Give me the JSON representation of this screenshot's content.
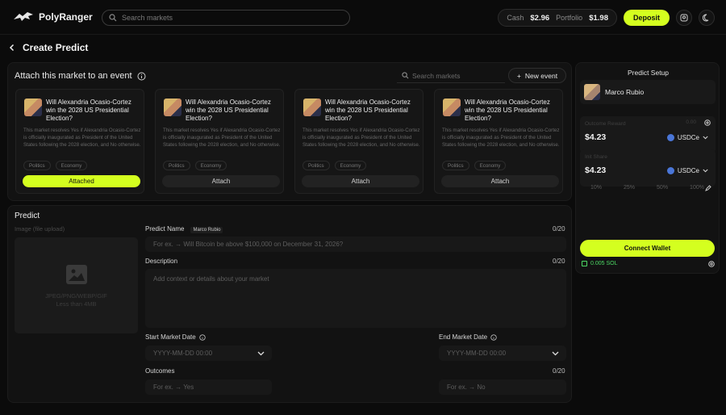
{
  "app": {
    "name": "PolyRanger"
  },
  "header": {
    "search_placeholder": "Search markets",
    "cash_label": "Cash",
    "cash_value": "$2.96",
    "portfolio_label": "Portfolio",
    "portfolio_value": "$1.98",
    "deposit_label": "Deposit"
  },
  "page": {
    "title": "Create Predict",
    "back_icon": "chevron-left-icon"
  },
  "events": {
    "heading": "Attach this market to an event",
    "search_placeholder": "Search markets",
    "new_event_label": "New event",
    "cards": [
      {
        "question": "Will Alexandria Ocasio-Cortez win the 2028 US Presidential Election?",
        "description": "This market resolves Yes if Alexandria Ocasio-Cortez is officially inaugurated as President of the United States following the 2028 election, and No otherwise.",
        "tags": [
          "Politics",
          "Economy"
        ],
        "button": "Attached"
      },
      {
        "question": "Will Alexandria Ocasio-Cortez win the 2028 US Presidential Election?",
        "description": "This market resolves Yes if Alexandria Ocasio-Cortez is officially inaugurated as President of the United States following the 2028 election, and No otherwise.",
        "tags": [
          "Politics",
          "Economy"
        ],
        "button": "Attach"
      },
      {
        "question": "Will Alexandria Ocasio-Cortez win the 2028 US Presidential Election?",
        "description": "This market resolves Yes if Alexandria Ocasio-Cortez is officially inaugurated as President of the United States following the 2028 election, and No otherwise.",
        "tags": [
          "Politics",
          "Economy"
        ],
        "button": "Attach"
      },
      {
        "question": "Will Alexandria Ocasio-Cortez win the 2028 US Presidential Election?",
        "description": "This market resolves Yes if Alexandria Ocasio-Cortez is officially inaugurated as President of the United States following the 2028 election, and No otherwise.",
        "tags": [
          "Politics",
          "Economy"
        ],
        "button": "Attach"
      }
    ]
  },
  "predict": {
    "title": "Predict",
    "image_label": "Image (file upload)",
    "image_formats": "JPEG/PNG/WEBP/GIF",
    "image_size": "Less than 4MB",
    "name_label": "Predict Name",
    "name_chip": "Marco Rubio",
    "name_count": "0/20",
    "name_placeholder": "For ex. → Will Bitcoin be above $100,000 on December 31, 2026?",
    "desc_label": "Description",
    "desc_count": "0/20",
    "desc_placeholder": "Add context or details about your market",
    "start_label": "Start Market Date",
    "end_label": "End Market Date",
    "date_placeholder": "YYYY-MM-DD  00:00",
    "outcomes_label": "Outcomes",
    "outcomes_count": "0/20",
    "yes_placeholder": "For ex. → Yes",
    "no_placeholder": "For ex. → No"
  },
  "setup": {
    "title": "Predict Setup",
    "user": "Marco Rubio",
    "reward_label": "Outcome Reward",
    "reward_balance": "0.00",
    "reward_value": "$4.23",
    "token": "USDCe",
    "share_label": "Init Share",
    "share_value": "$4.23",
    "percents": [
      "10%",
      "25%",
      "50%",
      "100%"
    ],
    "connect_label": "Connect Wallet",
    "sol_balance": "0.005 SOL"
  },
  "colors": {
    "accent": "#d4ff1f",
    "background": "#0b0b0b"
  }
}
